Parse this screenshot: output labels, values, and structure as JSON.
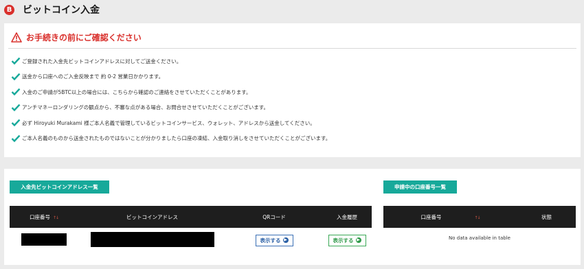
{
  "page": {
    "icon_letter": "B",
    "title": "ビットコイン入金"
  },
  "notice": {
    "title": "お手続きの前にご確認ください",
    "items": [
      "ご登録された入金先ビットコインアドレスに対してご送金ください。",
      "送金から口座へのご入金反映まで 約 0-2 営業日かかります。",
      "入金のご申請が5BTC以上の場合には、こちらから確認のご連絡をさせていただくことがあります。",
      "アンチマネーロンダリングの観点から、不審な点がある場合、お問合せさせていただくことがございます。",
      "必ず Hiroyuki Murakami 様ご本人名義で管理しているビットコインサービス、ウォレット、アドレスから送金してください。",
      "ご本人名義のものから送金されたものではないことが分かりましたら口座の凍結、入金取り消しをさせていただくことがございます。"
    ]
  },
  "addresses": {
    "section_label": "入金先ビットコインアドレス一覧",
    "columns": [
      "口座番号",
      "ビットコインアドレス",
      "QRコード",
      "入金履歴"
    ],
    "sort_glyph": "↑↓",
    "rows": [
      {
        "qr_label": "表示する",
        "history_label": "表示する"
      }
    ]
  },
  "accounts": {
    "section_label": "申請中の口座番号一覧",
    "columns": [
      "口座番号",
      "状態"
    ],
    "sort_glyph": "↑↓",
    "empty_text": "No data available in table"
  },
  "colors": {
    "accent": "#17a99a",
    "warning": "#d9302c",
    "header_bg": "#1e1e1e",
    "check": "#17a99a"
  },
  "icons": {
    "title": "bitcoin-icon",
    "notice": "warning-triangle-icon",
    "item": "checkmark-icon",
    "button_arrow": "arrow-right-circle-icon"
  }
}
